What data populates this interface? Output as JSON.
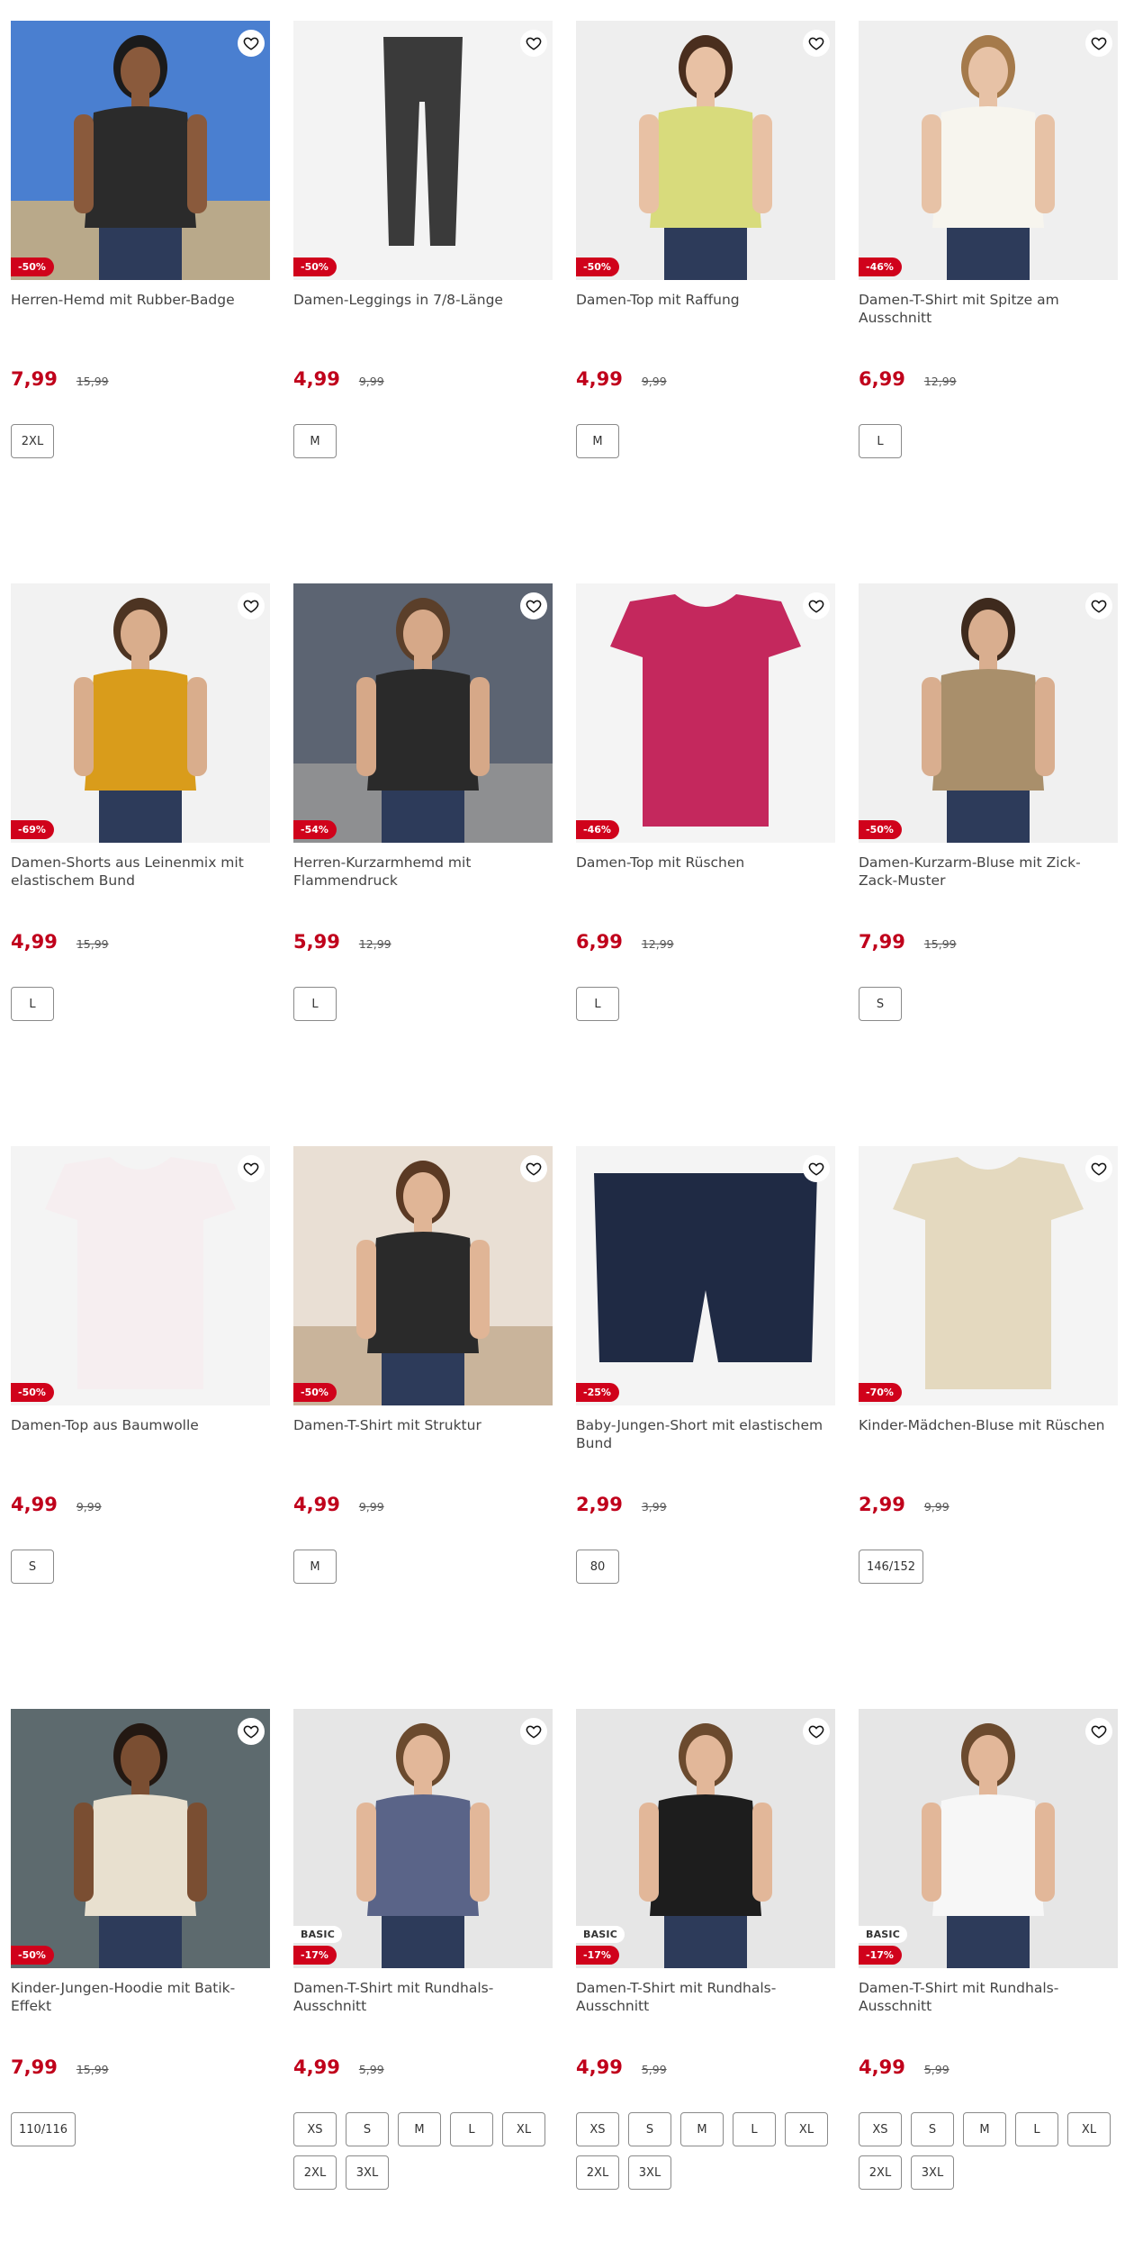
{
  "products": [
    {
      "title": "Herren-Hemd mit Rubber-Badge",
      "discount": "-50%",
      "price": "7,99",
      "old_price": "15,99",
      "sizes": [
        "2XL"
      ],
      "basic": ""
    },
    {
      "title": "Damen-Leggings in 7/8-Länge",
      "discount": "-50%",
      "price": "4,99",
      "old_price": "9,99",
      "sizes": [
        "M"
      ],
      "basic": ""
    },
    {
      "title": "Damen-Top mit Raffung",
      "discount": "-50%",
      "price": "4,99",
      "old_price": "9,99",
      "sizes": [
        "M"
      ],
      "basic": ""
    },
    {
      "title": "Damen-T-Shirt mit Spitze am Ausschnitt",
      "discount": "-46%",
      "price": "6,99",
      "old_price": "12,99",
      "sizes": [
        "L"
      ],
      "basic": ""
    },
    {
      "title": "Damen-Shorts aus Leinenmix mit elastischem Bund",
      "discount": "-69%",
      "price": "4,99",
      "old_price": "15,99",
      "sizes": [
        "L"
      ],
      "basic": ""
    },
    {
      "title": "Herren-Kurzarmhemd mit Flammendruck",
      "discount": "-54%",
      "price": "5,99",
      "old_price": "12,99",
      "sizes": [
        "L"
      ],
      "basic": ""
    },
    {
      "title": "Damen-Top mit Rüschen",
      "discount": "-46%",
      "price": "6,99",
      "old_price": "12,99",
      "sizes": [
        "L"
      ],
      "basic": ""
    },
    {
      "title": "Damen-Kurzarm-Bluse mit Zick-Zack-Muster",
      "discount": "-50%",
      "price": "7,99",
      "old_price": "15,99",
      "sizes": [
        "S"
      ],
      "basic": ""
    },
    {
      "title": "Damen-Top aus Baumwolle",
      "discount": "-50%",
      "price": "4,99",
      "old_price": "9,99",
      "sizes": [
        "S"
      ],
      "basic": ""
    },
    {
      "title": "Damen-T-Shirt mit Struktur",
      "discount": "-50%",
      "price": "4,99",
      "old_price": "9,99",
      "sizes": [
        "M"
      ],
      "basic": ""
    },
    {
      "title": "Baby-Jungen-Short mit elastischem Bund",
      "discount": "-25%",
      "price": "2,99",
      "old_price": "3,99",
      "sizes": [
        "80"
      ],
      "basic": ""
    },
    {
      "title": "Kinder-Mädchen-Bluse mit Rüschen",
      "discount": "-70%",
      "price": "2,99",
      "old_price": "9,99",
      "sizes": [
        "146/152"
      ],
      "basic": ""
    },
    {
      "title": "Kinder-Jungen-Hoodie mit Batik-Effekt",
      "discount": "-50%",
      "price": "7,99",
      "old_price": "15,99",
      "sizes": [
        "110/116"
      ],
      "basic": ""
    },
    {
      "title": "Damen-T-Shirt mit Rundhals-Ausschnitt",
      "discount": "-17%",
      "price": "4,99",
      "old_price": "5,99",
      "sizes": [
        "XS",
        "S",
        "M",
        "L",
        "XL",
        "2XL",
        "3XL"
      ],
      "basic": "BASIC"
    },
    {
      "title": "Damen-T-Shirt mit Rundhals-Ausschnitt",
      "discount": "-17%",
      "price": "4,99",
      "old_price": "5,99",
      "sizes": [
        "XS",
        "S",
        "M",
        "L",
        "XL",
        "2XL",
        "3XL"
      ],
      "basic": "BASIC"
    },
    {
      "title": "Damen-T-Shirt mit Rundhals-Ausschnitt",
      "discount": "-17%",
      "price": "4,99",
      "old_price": "5,99",
      "sizes": [
        "XS",
        "S",
        "M",
        "L",
        "XL",
        "2XL",
        "3XL"
      ],
      "basic": "BASIC"
    }
  ],
  "colors": {
    "price": "#c0001b",
    "discount_badge": "#d0021b",
    "image_bg": "#f1f1f1"
  },
  "icons": {
    "wishlist": "heart-outline-icon",
    "product_image": "product-photo"
  }
}
